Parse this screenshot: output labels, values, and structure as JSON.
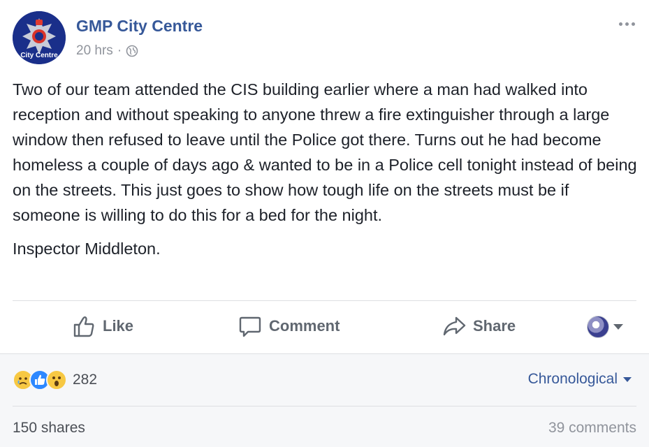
{
  "post": {
    "page_name": "GMP City Centre",
    "avatar_text": "City Centre",
    "timestamp": "20 hrs",
    "separator": "·",
    "privacy_icon": "globe-icon",
    "paragraphs": [
      "Two of our team attended the CIS building earlier where a man had walked into reception and without speaking to anyone threw a fire extinguisher through a large window then refused to leave until the Police got there. Turns out he had become homeless a couple of days ago & wanted to be in a Police cell tonight instead of being on the streets. This just goes to show how tough life on the streets must be if someone is willing to do this for a bed for the night."
    ],
    "signature": "Inspector Middleton."
  },
  "actions": {
    "like": "Like",
    "comment": "Comment",
    "share": "Share"
  },
  "footer": {
    "reaction_count": "282",
    "reaction_types": [
      "sad",
      "like",
      "wow"
    ],
    "sort_label": "Chronological",
    "shares": "150 shares",
    "comments": "39 comments"
  },
  "colors": {
    "link_blue": "#365899",
    "meta_gray": "#90949c",
    "action_gray": "#606770",
    "footer_bg": "#f6f7f9",
    "badge_blue": "#1a2f8a"
  }
}
